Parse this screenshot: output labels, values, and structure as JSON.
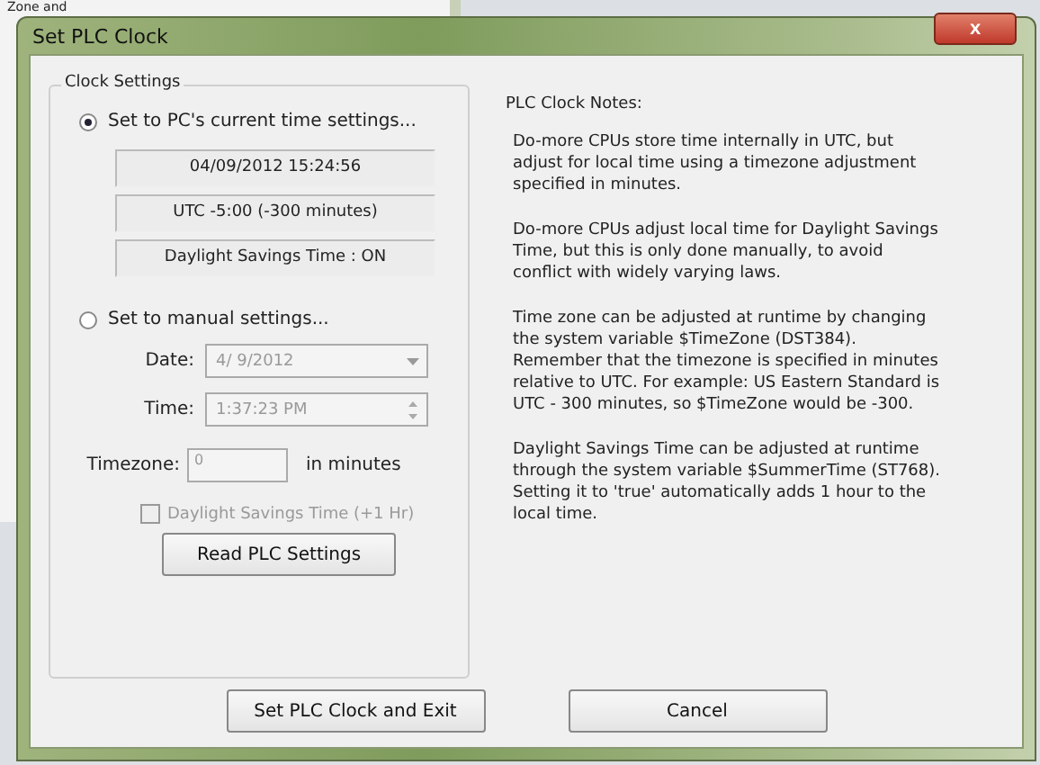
{
  "background_window": {
    "text": "Zone and"
  },
  "window": {
    "title": "Set PLC Clock",
    "close": "x"
  },
  "group": {
    "title": "Clock Settings",
    "options": [
      {
        "label": "Set to PC's current time settings...",
        "selected": true
      },
      {
        "label": "Set to manual settings...",
        "selected": false
      }
    ],
    "readouts": [
      "04/09/2012 15:24:56",
      "UTC -5:00 (-300 minutes)",
      "Daylight Savings Time : ON"
    ],
    "date": {
      "label": "Date:",
      "value": "4/ 9/2012",
      "disabled": true
    },
    "time": {
      "label": "Time:",
      "value": "1:37:23 PM",
      "disabled": true
    },
    "timezone": {
      "label": "Timezone:",
      "value": "0",
      "unit": "in minutes",
      "disabled": true
    },
    "dst_checkbox": {
      "label": "Daylight Savings Time (+1 Hr)",
      "checked": false,
      "disabled": true
    },
    "read_button": "Read PLC Settings"
  },
  "notes": {
    "title": "PLC Clock Notes:",
    "paragraphs": [
      "Do-more CPUs store time internally in UTC, but adjust for local time using a timezone adjustment specified in minutes.",
      "Do-more CPUs adjust local time for Daylight Savings Time, but this is only done manually, to avoid conflict with widely varying laws.",
      "Time zone can be adjusted at runtime by changing the system variable $TimeZone (DST384). Remember that the timezone is specified in minutes relative to UTC. For example: US Eastern Standard  is UTC - 300 minutes, so $TimeZone would be -300.",
      "Daylight Savings Time can be adjusted at runtime through the system variable $SummerTime (ST768). Setting it to 'true' automatically adds 1 hour to the local time."
    ]
  },
  "buttons": [
    "Set PLC Clock and Exit",
    "Cancel"
  ]
}
